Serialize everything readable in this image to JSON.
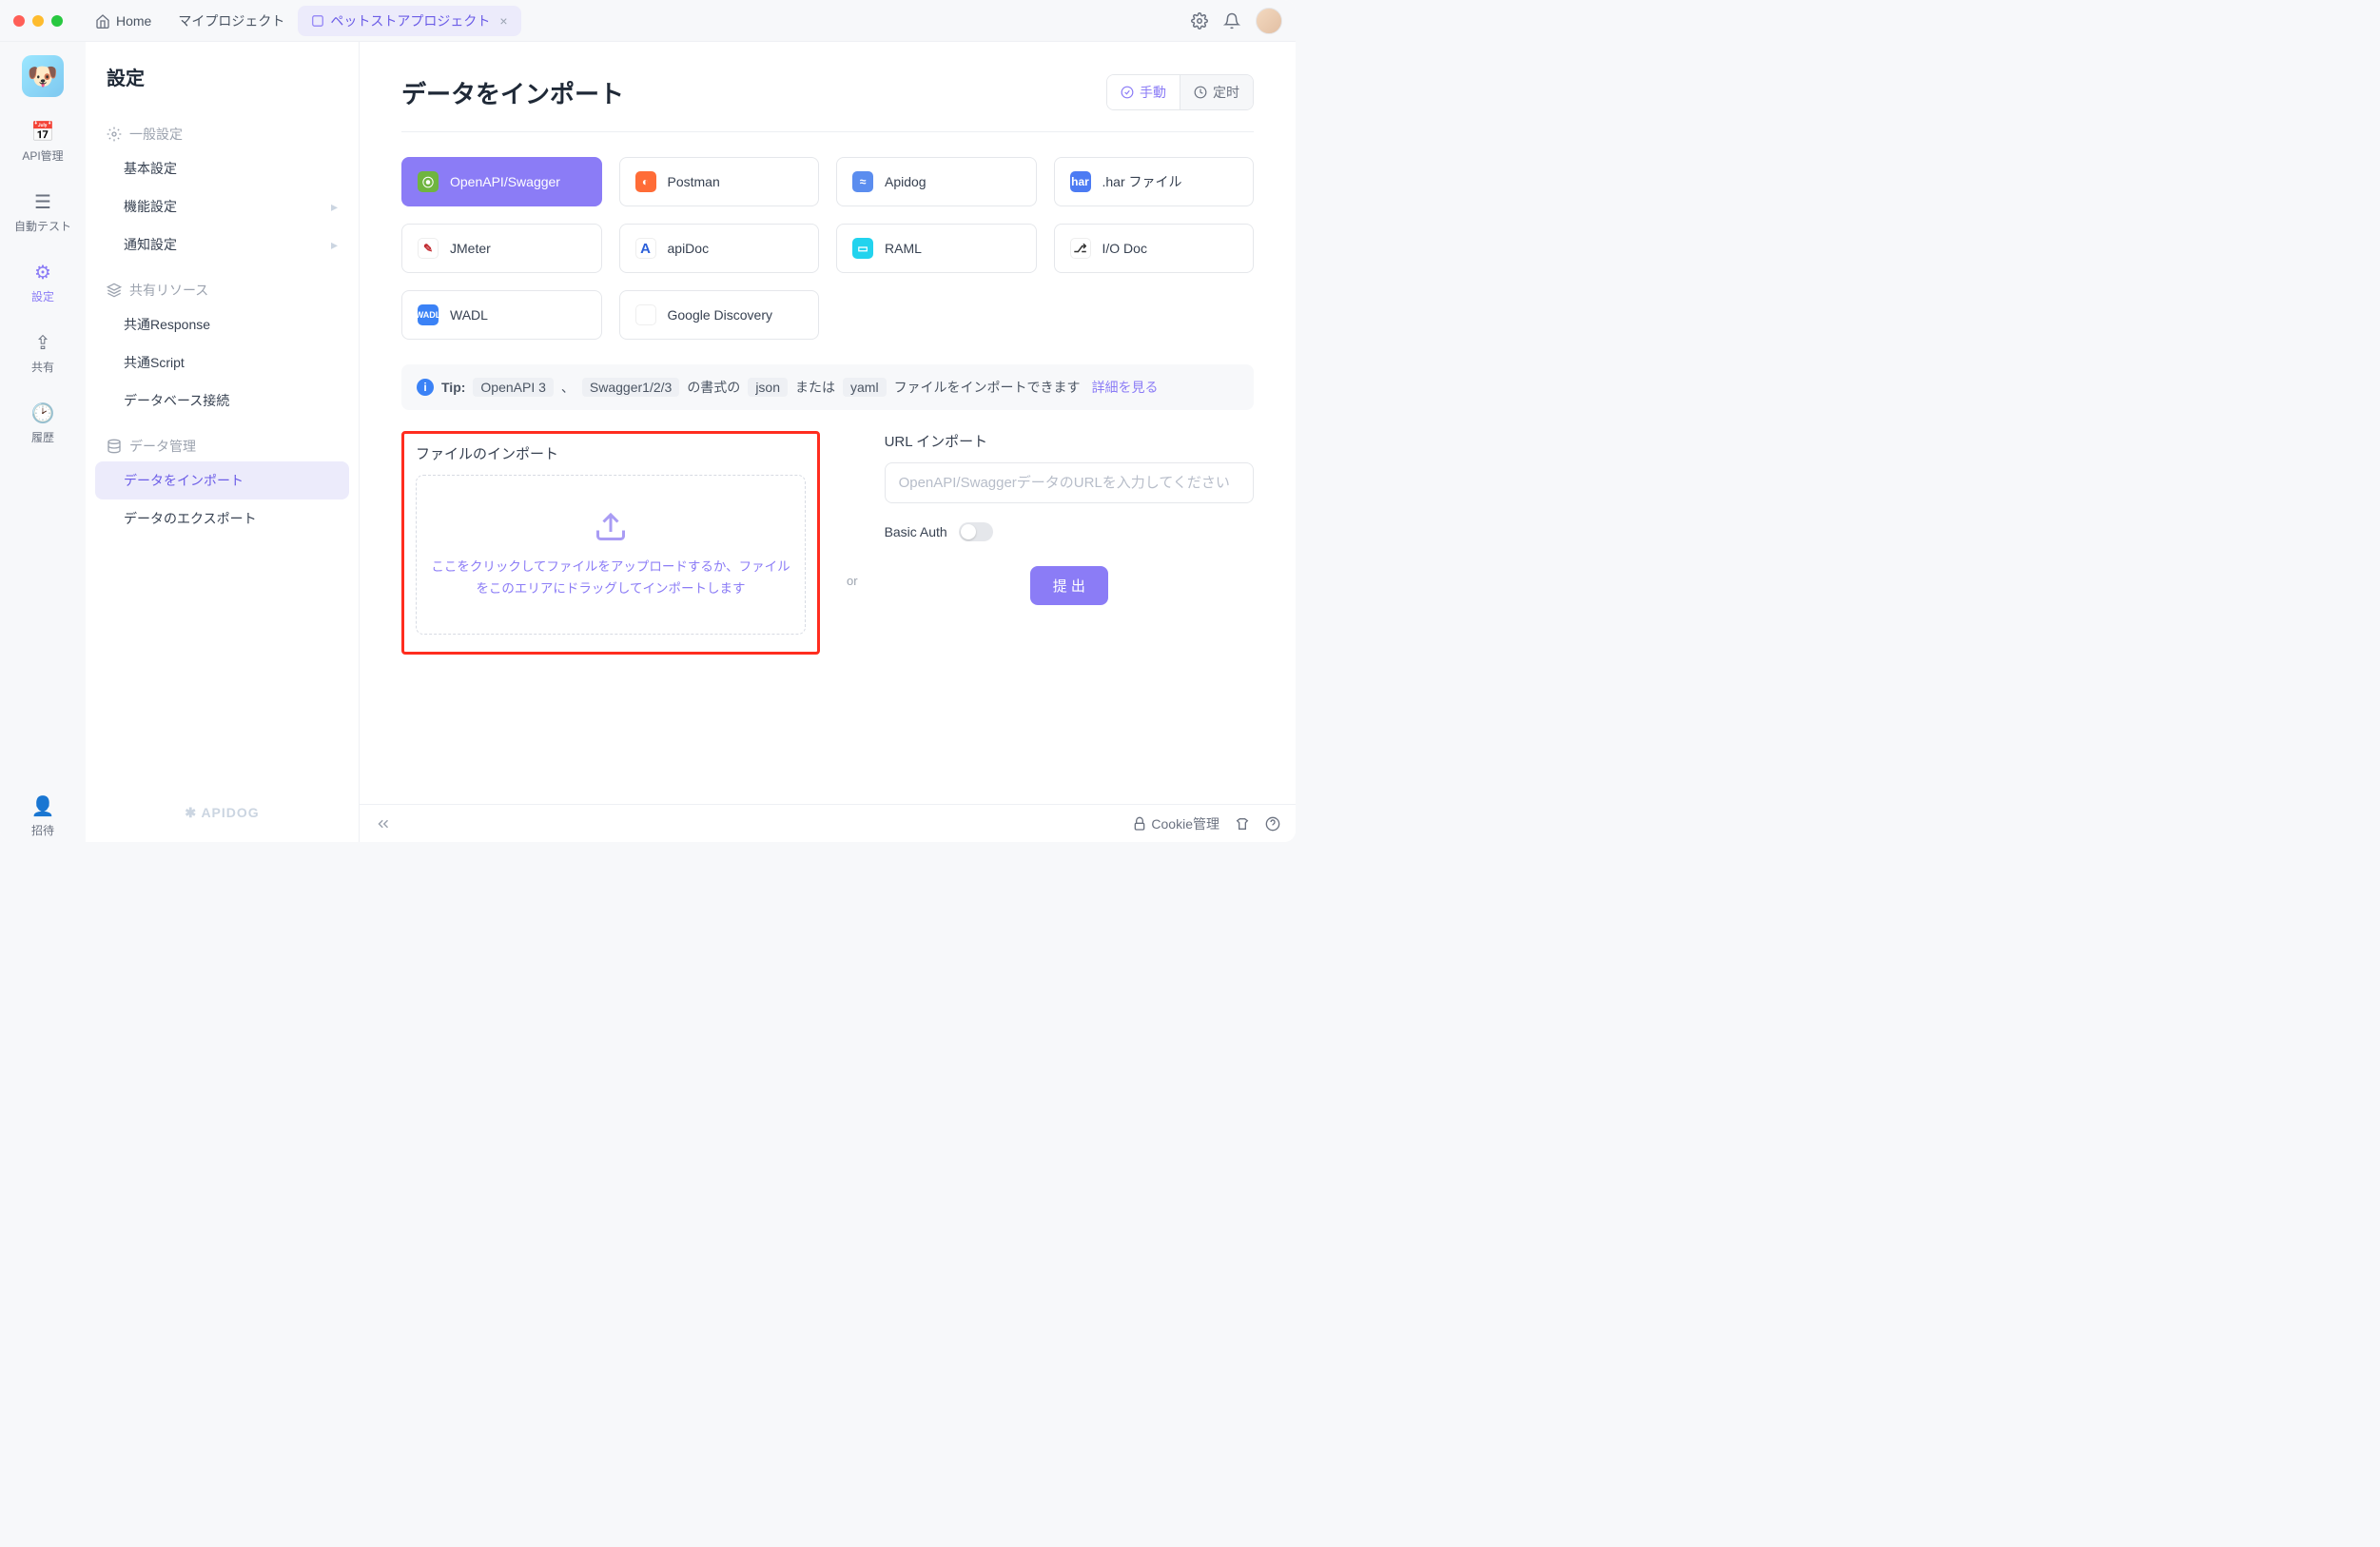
{
  "titlebar": {
    "home": "Home",
    "tab1": "マイプロジェクト",
    "tab2": "ペットストアプロジェクト"
  },
  "rail": {
    "api": "API管理",
    "autotest": "自動テスト",
    "settings": "設定",
    "share": "共有",
    "history": "履歴",
    "invite": "招待"
  },
  "sidebar": {
    "title": "設定",
    "g1": {
      "head": "一般設定",
      "i1": "基本設定",
      "i2": "機能設定",
      "i3": "通知設定"
    },
    "g2": {
      "head": "共有リソース",
      "i1": "共通Response",
      "i2": "共通Script",
      "i3": "データベース接続"
    },
    "g3": {
      "head": "データ管理",
      "i1": "データをインポート",
      "i2": "データのエクスポート"
    },
    "brand": "APIDOG"
  },
  "page": {
    "title": "データをインポート",
    "seg_manual": "手動",
    "seg_scheduled": "定时"
  },
  "formats": {
    "openapi": "OpenAPI/Swagger",
    "postman": "Postman",
    "apidog": "Apidog",
    "har": ".har ファイル",
    "jmeter": "JMeter",
    "apidoc": "apiDoc",
    "raml": "RAML",
    "iodoc": "I/O Doc",
    "wadl": "WADL",
    "google": "Google Discovery"
  },
  "tip": {
    "label": "Tip:",
    "c1": "OpenAPI 3",
    "t1": "、",
    "c2": "Swagger1/2/3",
    "t2": "の書式の",
    "c3": "json",
    "t3": "または",
    "c4": "yaml",
    "t4": "ファイルをインポートできます",
    "link": "詳細を見る"
  },
  "file": {
    "head": "ファイルのインポート",
    "droptext": "ここをクリックしてファイルをアップロードするか、ファイルをこのエリアにドラッグしてインポートします"
  },
  "or": "or",
  "url": {
    "head": "URL インポート",
    "placeholder": "OpenAPI/SwaggerデータのURLを入力してください",
    "basic": "Basic Auth",
    "submit": "提 出"
  },
  "footer": {
    "cookie": "Cookie管理"
  }
}
